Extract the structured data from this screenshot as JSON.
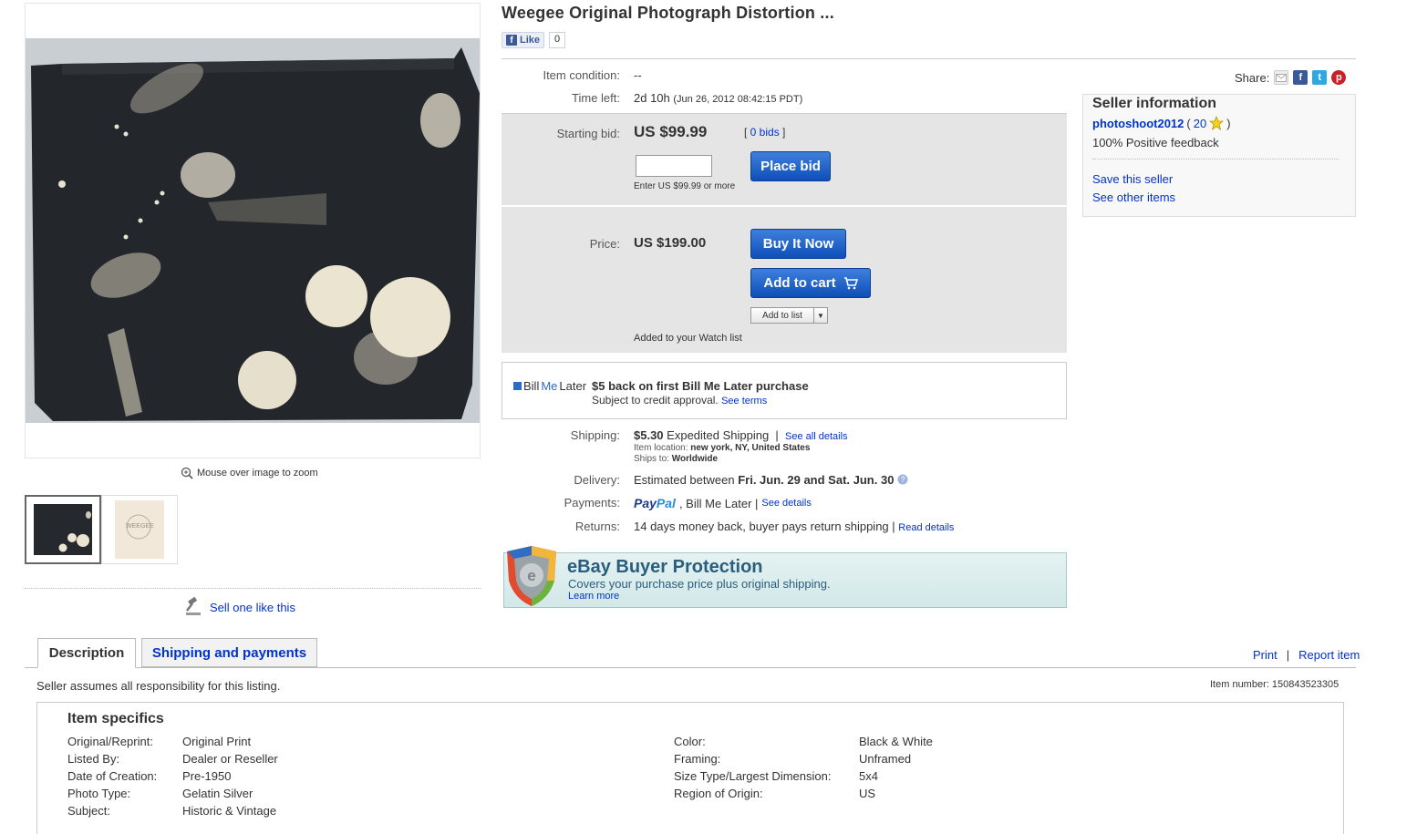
{
  "listing": {
    "title": "Weegee Original Photograph Distortion ...",
    "fb_like": "Like",
    "fb_count": "0"
  },
  "gallery": {
    "zoom_hint": "Mouse over image to zoom",
    "thumb2_stamp": "WEEGEE",
    "sell_one": "Sell one like this"
  },
  "details": {
    "condition_label": "Item condition:",
    "condition_value": "--",
    "time_label": "Time left:",
    "time_value": "2d 10h",
    "time_end": "(Jun 26, 2012 08:42:15 PDT)",
    "start_label": "Starting bid:",
    "start_price": "US $99.99",
    "bids_link": "0 bids",
    "place_bid": "Place bid",
    "bid_hint": "Enter US $99.99 or more",
    "price_label": "Price:",
    "price_value": "US $199.00",
    "buy_now": "Buy It Now",
    "add_cart": "Add to cart",
    "add_list": "Add to list",
    "watch_note": "Added to your Watch list"
  },
  "bml": {
    "logo_bill": "Bill",
    "logo_me": "Me",
    "logo_later": "Later",
    "offer": "$5 back on first Bill Me Later purchase",
    "sub": "Subject to credit approval.",
    "terms": "See terms"
  },
  "shipping": {
    "label": "Shipping:",
    "cost": "$5.30",
    "method": "Expedited Shipping",
    "details_link": "See all details",
    "location_label": "Item location:",
    "location": "new york, NY, United States",
    "ships_label": "Ships to:",
    "ships_to": "Worldwide",
    "delivery_label": "Delivery:",
    "delivery_prefix": "Estimated between",
    "delivery_range": "Fri. Jun. 29 and Sat. Jun. 30",
    "payments_label": "Payments:",
    "paypal_pay": "Pay",
    "paypal_pal": "Pal",
    "payments_other": ", Bill Me Later |",
    "payments_link": "See details",
    "returns_label": "Returns:",
    "returns_value": "14 days money back, buyer pays return shipping |",
    "returns_link": "Read details"
  },
  "protection": {
    "title": "eBay Buyer Protection",
    "sub": "Covers your purchase price plus original shipping.",
    "learn": "Learn more"
  },
  "share": {
    "label": "Share:"
  },
  "seller": {
    "heading": "Seller information",
    "name": "photoshoot2012",
    "score": "20",
    "feedback": "100% Positive feedback",
    "save": "Save this seller",
    "other": "See other items"
  },
  "tabs": {
    "description": "Description",
    "shipping": "Shipping and payments",
    "print": "Print",
    "report": "Report item"
  },
  "specifics": {
    "assumes": "Seller assumes all responsibility for this listing.",
    "item_number": "Item number: 150843523305",
    "title": "Item specifics",
    "left": [
      {
        "label": "Original/Reprint:",
        "value": "Original Print"
      },
      {
        "label": "Listed By:",
        "value": "Dealer or Reseller"
      },
      {
        "label": "Date of Creation:",
        "value": "Pre-1950"
      },
      {
        "label": "Photo Type:",
        "value": "Gelatin Silver"
      },
      {
        "label": "Subject:",
        "value": "Historic & Vintage"
      }
    ],
    "right": [
      {
        "label": "Color:",
        "value": "Black & White"
      },
      {
        "label": "Framing:",
        "value": "Unframed"
      },
      {
        "label": "Size Type/Largest Dimension:",
        "value": "5x4"
      },
      {
        "label": "Region of Origin:",
        "value": "US"
      }
    ]
  },
  "colors": {
    "link": "#0033cc",
    "button_blue": "#0e4fb8",
    "panel_gray": "#e5e5e5",
    "protect_teal": "#2b5d7d"
  },
  "icons": [
    "magnifier-zoom-icon",
    "gavel-icon",
    "cart-icon",
    "help-icon",
    "star-icon",
    "email-icon",
    "facebook-icon",
    "twitter-icon",
    "pinterest-icon",
    "shield-icon"
  ]
}
